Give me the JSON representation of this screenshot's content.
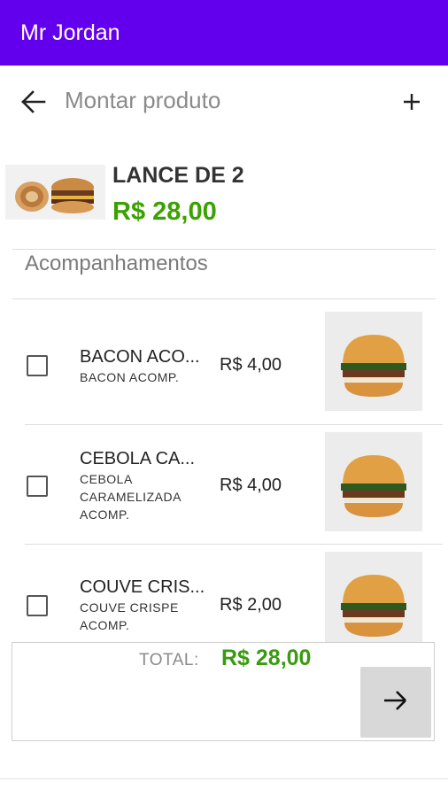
{
  "app": {
    "title": "Mr Jordan",
    "accent": "#6200ee"
  },
  "toolbar": {
    "title": "Montar produto",
    "back_icon": "arrow-left-icon",
    "add_icon": "plus-icon"
  },
  "product": {
    "name": "LANCE DE 2",
    "price": "R$ 28,00",
    "price_color": "#3aa200"
  },
  "section": {
    "title": "Acompanhamentos"
  },
  "items": [
    {
      "name": "BACON ACO...",
      "description": "BACON ACOMP.",
      "price": "R$ 4,00",
      "checked": false
    },
    {
      "name": "CEBOLA CA...",
      "description": "CEBOLA CARAMELIZADA ACOMP.",
      "price": "R$ 4,00",
      "checked": false
    },
    {
      "name": "COUVE CRIS...",
      "description": "COUVE CRISPE ACOMP.",
      "price": "R$ 2,00",
      "checked": false
    }
  ],
  "footer": {
    "total_label": "TOTAL:",
    "total_value": "R$ 28,00",
    "next_icon": "arrow-right-icon"
  }
}
